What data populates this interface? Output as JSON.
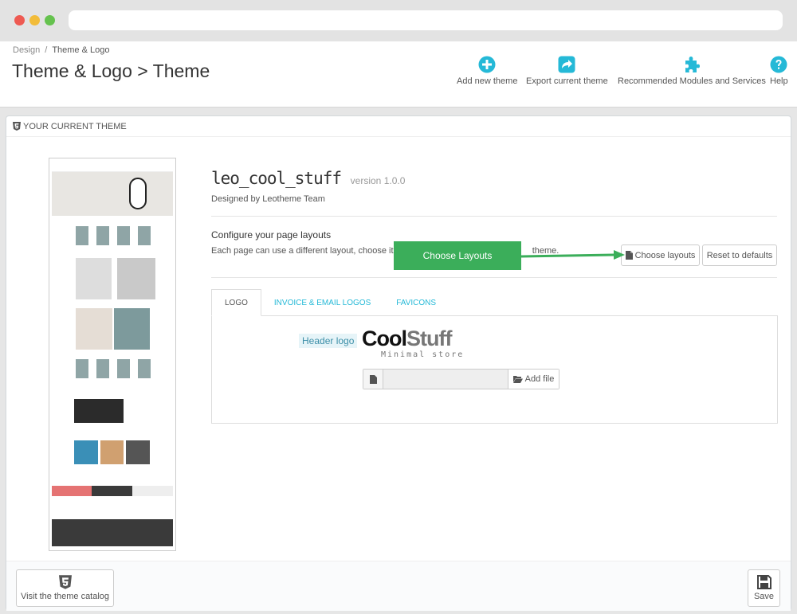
{
  "header": {
    "breadcrumb": {
      "parent": "Design",
      "current": "Theme & Logo"
    },
    "title": "Theme & Logo > Theme",
    "toolbar": [
      {
        "label": "Add new theme",
        "icon": "add-circle-icon"
      },
      {
        "label": "Export current theme",
        "icon": "export-share-icon"
      },
      {
        "label": "Recommended Modules and Services",
        "icon": "puzzle-icon"
      },
      {
        "label": "Help",
        "icon": "help-circle-icon"
      }
    ]
  },
  "panel": {
    "heading": "Your current theme",
    "theme": {
      "name": "leo_cool_stuff",
      "version": "version 1.0.0",
      "designer": "Designed by Leotheme Team"
    },
    "layouts": {
      "title": "Configure your page layouts",
      "description_start": "Each page can use a different layout, choose it a",
      "description_end": "theme.",
      "choose_button": "Choose layouts",
      "reset_button": "Reset to defaults",
      "callout": "Choose Layouts"
    },
    "tabs": [
      {
        "label": "Logo",
        "active": true
      },
      {
        "label": "Invoice & Email Logos",
        "active": false
      },
      {
        "label": "Favicons",
        "active": false
      }
    ],
    "logo_tab": {
      "label": "Header logo",
      "logo_word_1": "Cool",
      "logo_word_2": "Stuff",
      "logo_tagline": "Minimal store",
      "add_file_button": "Add file"
    },
    "footer": {
      "catalog_button": "Visit the theme catalog",
      "save_button": "Save"
    }
  },
  "colors": {
    "accent": "#25b9d7",
    "callout": "#3bae5a",
    "preview_pink": "#e57373",
    "preview_dark": "#3a3a3a"
  }
}
